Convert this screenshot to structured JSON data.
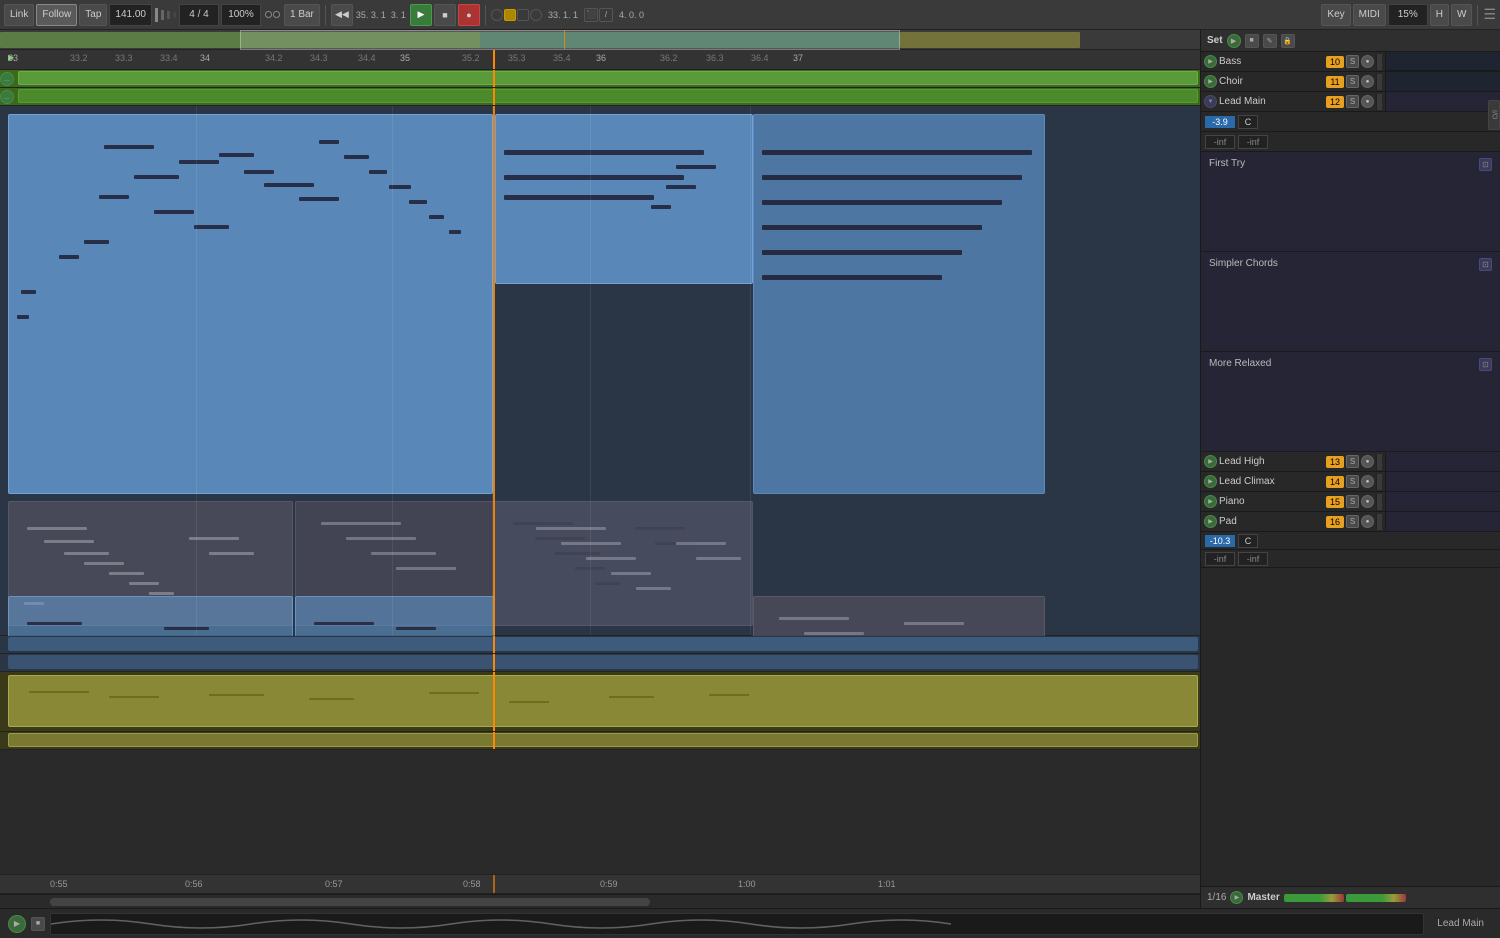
{
  "toolbar": {
    "link_label": "Link",
    "follow_label": "Follow",
    "tap_label": "Tap",
    "tempo": "141.00",
    "time_sig": "4 / 4",
    "zoom": "100%",
    "metronome": "1 Bar",
    "transport_pos": "35. 3. 1",
    "transport_pos2": "33. 1. 1",
    "beats_display": "4. 0. 0",
    "key_label": "Key",
    "midi_label": "MIDI",
    "cpu_label": "15%",
    "hw_label": "H",
    "warp_label": "W"
  },
  "ruler": {
    "marks": [
      "33",
      "33.2",
      "33.3",
      "33.4",
      "34",
      "34.2",
      "34.3",
      "34.4",
      "35",
      "35.2",
      "35.3",
      "35.4",
      "36",
      "36.2",
      "36.3",
      "36.4",
      "37"
    ]
  },
  "timeline": {
    "marks": [
      "0:55",
      "0:56",
      "0:57",
      "0:58",
      "0:59",
      "1:00",
      "1:01"
    ]
  },
  "tracks": {
    "bass": {
      "name": "Bass",
      "number": "10",
      "s": "S",
      "mute": "●"
    },
    "choir": {
      "name": "Choir",
      "number": "11",
      "s": "S",
      "mute": "●"
    },
    "lead_main": {
      "name": "Lead Main",
      "number": "12",
      "s": "S",
      "mute": "●",
      "vol": "-3.9",
      "key": "C",
      "inf1": "-inf",
      "inf2": "-inf"
    },
    "lead_high": {
      "name": "Lead High",
      "number": "13",
      "s": "S",
      "mute": "●"
    },
    "lead_climax": {
      "name": "Lead Climax",
      "number": "14",
      "s": "S",
      "mute": "●"
    },
    "piano": {
      "name": "Piano",
      "number": "15",
      "s": "S",
      "mute": "●"
    },
    "pad": {
      "name": "Pad",
      "number": "16",
      "s": "S",
      "mute": "●",
      "vol": "-10.3",
      "key": "C",
      "inf1": "-inf",
      "inf2": "-inf"
    }
  },
  "scenes": {
    "first_try": "First Try",
    "simpler_chords": "Simpler Chords",
    "more_relaxed": "More Relaxed"
  },
  "set_label": "Set",
  "master_label": "Master",
  "fraction": "1/16",
  "bottom_bar": {
    "info": "Lead Main"
  }
}
